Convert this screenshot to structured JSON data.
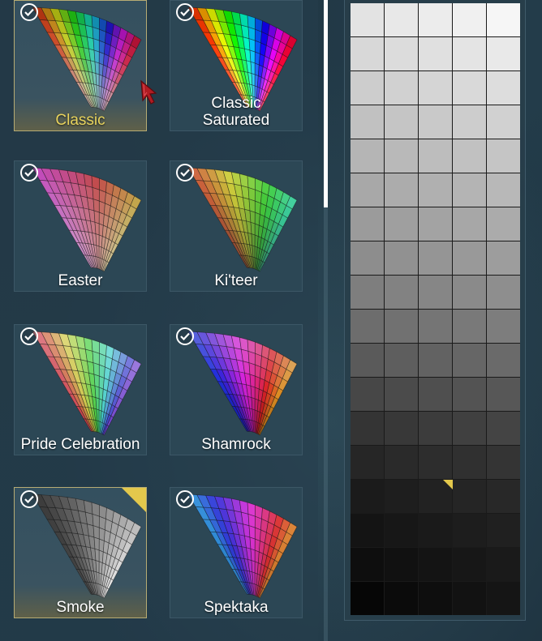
{
  "palettes": [
    {
      "label": "Classic",
      "selected": true,
      "active": true,
      "checked": true,
      "corner_flag": false,
      "fan": {
        "hue_start": 0,
        "hue_end": 360,
        "sat": [
          0.25,
          0.85
        ],
        "light": [
          0.75,
          0.35
        ]
      }
    },
    {
      "label": "Classic\nSaturated",
      "selected": false,
      "active": false,
      "checked": true,
      "corner_flag": false,
      "fan": {
        "hue_start": 0,
        "hue_end": 360,
        "sat": [
          0.9,
          1.0
        ],
        "light": [
          0.65,
          0.42
        ]
      }
    },
    {
      "label": "Easter",
      "selected": false,
      "active": false,
      "checked": true,
      "corner_flag": false,
      "fan": {
        "hue_start": 300,
        "hue_end": 410,
        "sat": [
          0.35,
          0.5
        ],
        "light": [
          0.72,
          0.52
        ]
      }
    },
    {
      "label": "Ki'teer",
      "selected": false,
      "active": false,
      "checked": true,
      "corner_flag": false,
      "fan": {
        "hue_start": 10,
        "hue_end": 165,
        "sat": [
          0.45,
          0.6
        ],
        "light": [
          0.35,
          0.55
        ]
      }
    },
    {
      "label": "Pride Celebration",
      "selected": false,
      "active": false,
      "checked": true,
      "corner_flag": false,
      "fan": {
        "hue_start": 345,
        "hue_end": 630,
        "sat": [
          0.55,
          0.6
        ],
        "light": [
          0.5,
          0.68
        ]
      }
    },
    {
      "label": "Shamrock",
      "selected": false,
      "active": false,
      "checked": true,
      "corner_flag": false,
      "fan": {
        "hue_start": 230,
        "hue_end": 400,
        "sat": [
          0.8,
          0.65
        ],
        "light": [
          0.35,
          0.62
        ]
      }
    },
    {
      "label": "Smoke",
      "selected": true,
      "active": false,
      "checked": true,
      "corner_flag": true,
      "fan": {
        "hue_start": 0,
        "hue_end": 0,
        "sat": [
          0,
          0
        ],
        "light": [
          0.15,
          0.85
        ]
      }
    },
    {
      "label": "Spektaka",
      "selected": false,
      "active": false,
      "checked": true,
      "corner_flag": false,
      "fan": {
        "hue_start": 200,
        "hue_end": 395,
        "sat": [
          0.6,
          0.7
        ],
        "light": [
          0.45,
          0.55
        ]
      }
    }
  ],
  "swatch_grid": {
    "columns": 5,
    "rows": 18,
    "picked": {
      "row": 14,
      "col": 2
    },
    "colors": [
      [
        "#e3e3e3",
        "#e8e8e8",
        "#ececec",
        "#f0f0f0",
        "#f6f6f6"
      ],
      [
        "#d8d8d8",
        "#dcdcdc",
        "#e0e0e0",
        "#e4e4e4",
        "#e9e9e9"
      ],
      [
        "#cdcdcd",
        "#d1d1d1",
        "#d5d5d5",
        "#d9d9d9",
        "#dddddd"
      ],
      [
        "#c1c1c1",
        "#c5c5c5",
        "#c9c9c9",
        "#cdcdcd",
        "#d1d1d1"
      ],
      [
        "#b5b5b5",
        "#b9b9b9",
        "#bdbdbd",
        "#c1c1c1",
        "#c5c5c5"
      ],
      [
        "#a8a8a8",
        "#acacac",
        "#b0b0b0",
        "#b4b4b4",
        "#b8b8b8"
      ],
      [
        "#9b9b9b",
        "#9f9f9f",
        "#a3a3a3",
        "#a7a7a7",
        "#ababab"
      ],
      [
        "#8d8d8d",
        "#919191",
        "#959595",
        "#999999",
        "#9d9d9d"
      ],
      [
        "#7e7e7e",
        "#828282",
        "#868686",
        "#8a8a8a",
        "#8e8e8e"
      ],
      [
        "#6d6d6d",
        "#717171",
        "#757575",
        "#797979",
        "#7d7d7d"
      ],
      [
        "#5a5a5a",
        "#5e5e5e",
        "#626262",
        "#666666",
        "#6a6a6a"
      ],
      [
        "#474747",
        "#4b4b4b",
        "#4f4f4f",
        "#535353",
        "#575757"
      ],
      [
        "#343434",
        "#383838",
        "#3c3c3c",
        "#404040",
        "#444444"
      ],
      [
        "#262626",
        "#2a2a2a",
        "#2d2d2d",
        "#303030",
        "#343434"
      ],
      [
        "#1b1b1b",
        "#1e1e1e",
        "#222222",
        "#252525",
        "#282828"
      ],
      [
        "#141414",
        "#171717",
        "#1a1a1a",
        "#1d1d1d",
        "#202020"
      ],
      [
        "#0e0e0e",
        "#111111",
        "#141414",
        "#171717",
        "#1a1a1a"
      ],
      [
        "#060606",
        "#0b0b0b",
        "#0e0e0e",
        "#121212",
        "#151515"
      ]
    ]
  },
  "scrollbar": {
    "position": 0
  }
}
